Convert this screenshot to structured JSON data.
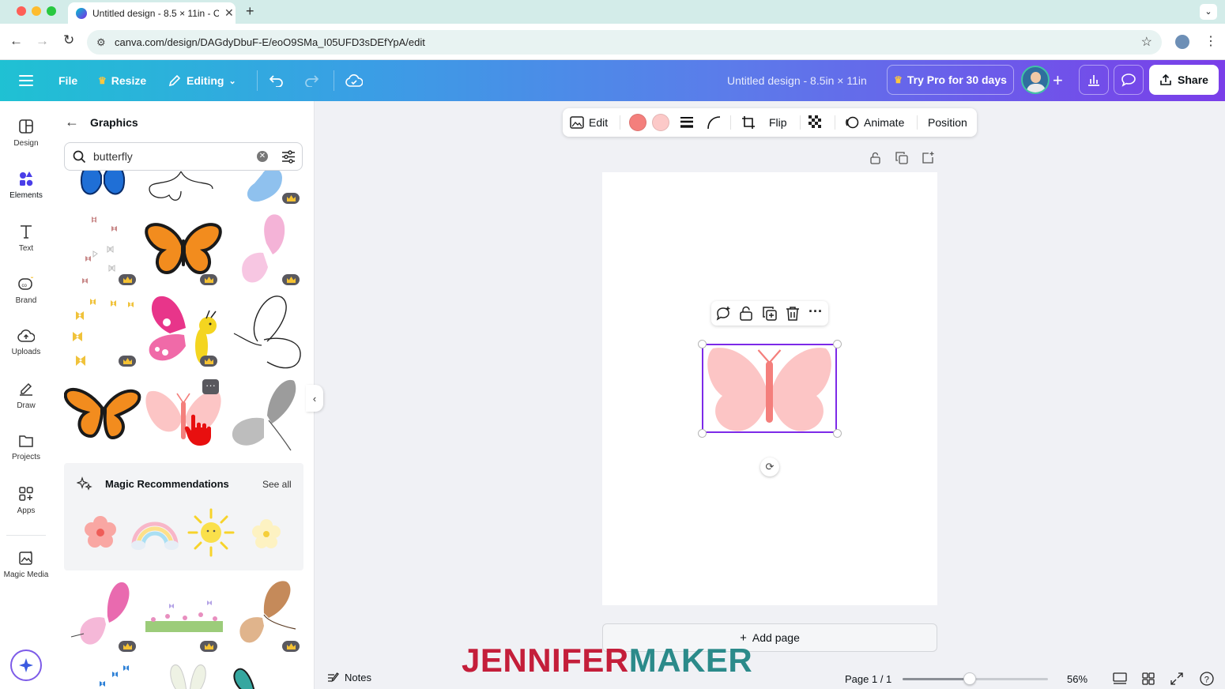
{
  "browser": {
    "tab_title": "Untitled design - 8.5 × 11in - C",
    "url": "canva.com/design/DAGdyDbuF-E/eoO9SMa_I05UFD3sDEfYpA/edit"
  },
  "header": {
    "menu_icon": "hamburger-icon",
    "file": "File",
    "resize": "Resize",
    "editing": "Editing",
    "design_title": "Untitled design - 8.5in × 11in",
    "try_pro": "Try Pro for 30 days",
    "share": "Share"
  },
  "rail": {
    "items": [
      {
        "label": "Design",
        "icon": "design-icon"
      },
      {
        "label": "Elements",
        "icon": "elements-icon"
      },
      {
        "label": "Text",
        "icon": "text-icon"
      },
      {
        "label": "Brand",
        "icon": "brand-icon"
      },
      {
        "label": "Uploads",
        "icon": "uploads-icon"
      },
      {
        "label": "Draw",
        "icon": "draw-icon"
      },
      {
        "label": "Projects",
        "icon": "folder-icon"
      },
      {
        "label": "Apps",
        "icon": "apps-icon"
      },
      {
        "label": "Magic Media",
        "icon": "magic-media-icon"
      }
    ]
  },
  "panel": {
    "title": "Graphics",
    "search_value": "butterfly",
    "magic_title": "Magic Recommendations",
    "see_all": "See all"
  },
  "toolbar": {
    "edit": "Edit",
    "flip": "Flip",
    "animate": "Animate",
    "position": "Position",
    "colors": [
      "#f47f7c",
      "#fcc9c8"
    ]
  },
  "canvas": {
    "add_page": "Add page",
    "butterfly_wing_color": "#fcc5c5",
    "butterfly_body_color": "#f47f7c",
    "selection_color": "#7d2ae8"
  },
  "bottom": {
    "notes": "Notes",
    "page_indicator": "Page 1 / 1",
    "zoom": "56%",
    "zoom_level": 0.56
  },
  "watermark": {
    "part1": "JENNIFER",
    "part2": "MAKER",
    "color1": "#c41e3a",
    "color2": "#2b8a8a"
  }
}
